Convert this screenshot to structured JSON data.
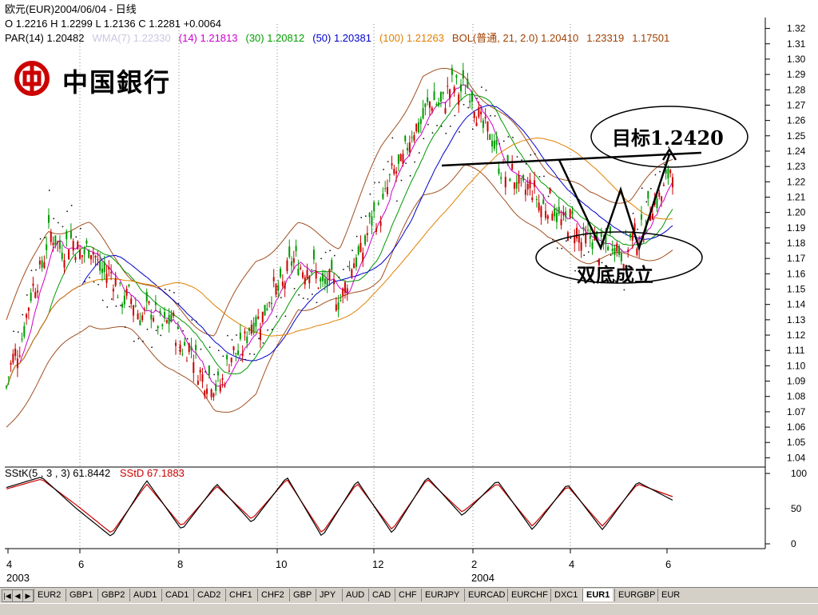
{
  "header": {
    "line1": "欧元(EUR)2004/06/04 - 日线",
    "line2": "O 1.2216 H 1.2299 L 1.2136 C 1.2281 +0.0064",
    "indicators": [
      {
        "text": "PAR(14)  1.20482",
        "color": "#000000"
      },
      {
        "text": "WMA(7) 1.22330",
        "color": "#c8c8e0"
      },
      {
        "text": "(14) 1.21813",
        "color": "#cc00cc"
      },
      {
        "text": "(30) 1.20812",
        "color": "#00a000"
      },
      {
        "text": "(50) 1.20381",
        "color": "#0000cc"
      },
      {
        "text": "(100) 1.21263",
        "color": "#e08000"
      },
      {
        "text": "BOL(普通, 21, 2.0)  1.20410",
        "color": "#a04000"
      },
      {
        "text": "1.23319",
        "color": "#a04000"
      },
      {
        "text": "1.17501",
        "color": "#a04000"
      }
    ]
  },
  "logo": {
    "text": "中国銀行",
    "color": "#cc0000"
  },
  "annotations": {
    "target": "目标1.2420",
    "pattern": "双底成立"
  },
  "stoch_header": {
    "k_label": "SStK(5 , 3 , 3)  61.8442",
    "d_label": "SStD  67.1883",
    "k_color": "#000000",
    "d_color": "#cc0000"
  },
  "tabs": [
    "EUR2",
    "GBP1",
    "GBP2",
    "AUD1",
    "CAD1",
    "CAD2",
    "CHF1",
    "CHF2",
    "GBP",
    "JPY",
    "AUD",
    "CAD",
    "CHF",
    "EURJPY",
    "EURCAD",
    "EURCHF",
    "DXC1",
    "EUR1",
    "EURGBP",
    "EUR"
  ],
  "active_tab": "EUR1",
  "chart_data": [
    {
      "type": "line",
      "title": "欧元(EUR)2004/06/04 - 日线",
      "y_ticks": [
        "1.32",
        "1.31",
        "1.30",
        "1.29",
        "1.28",
        "1.27",
        "1.26",
        "1.25",
        "1.24",
        "1.23",
        "1.22",
        "1.21",
        "1.20",
        "1.19",
        "1.18",
        "1.17",
        "1.16",
        "1.15",
        "1.14",
        "1.13",
        "1.12",
        "1.11",
        "1.10",
        "1.09",
        "1.08",
        "1.07",
        "1.06",
        "1.05",
        "1.04"
      ],
      "ylim": [
        1.035,
        1.325
      ],
      "x_ticks": [
        "4",
        "6",
        "8",
        "10",
        "12",
        "2",
        "4",
        "6"
      ],
      "x_year_labels": [
        "2003",
        "2004"
      ],
      "colors": {
        "price": "#009900",
        "up": "#cc0000",
        "wma7": "#cc00cc",
        "ma30": "#009900",
        "ma50": "#0000cc",
        "ma100": "#e08000",
        "boll": "#a05020",
        "sar": "#000000"
      },
      "x": [
        "2003-04",
        "2003-05",
        "2003-06",
        "2003-06b",
        "2003-07",
        "2003-08",
        "2003-09",
        "2003-10",
        "2003-11",
        "2003-12",
        "2004-01",
        "2004-02",
        "2004-03",
        "2004-04",
        "2004-05",
        "2004-05b",
        "2004-06"
      ],
      "series": [
        {
          "name": "Close",
          "values": [
            1.086,
            1.183,
            1.175,
            1.14,
            1.125,
            1.085,
            1.13,
            1.17,
            1.145,
            1.205,
            1.265,
            1.285,
            1.225,
            1.205,
            1.18,
            1.178,
            1.228
          ]
        },
        {
          "name": "BOL upper",
          "values": [
            1.13,
            1.19,
            1.19,
            1.16,
            1.14,
            1.12,
            1.17,
            1.19,
            1.18,
            1.24,
            1.29,
            1.29,
            1.26,
            1.23,
            1.21,
            1.21,
            1.235
          ]
        },
        {
          "name": "BOL lower",
          "values": [
            1.06,
            1.1,
            1.13,
            1.12,
            1.1,
            1.07,
            1.08,
            1.14,
            1.14,
            1.16,
            1.21,
            1.23,
            1.21,
            1.18,
            1.17,
            1.17,
            1.175
          ]
        }
      ],
      "annotations": [
        {
          "text": "目标1.2420",
          "value": 1.242
        },
        {
          "text": "双底成立"
        }
      ]
    },
    {
      "type": "line",
      "title": "SStK(5 , 3 , 3)",
      "y_ticks": [
        "100",
        "50",
        "0"
      ],
      "ylim": [
        0,
        100
      ],
      "series": [
        {
          "name": "SStK",
          "values": [
            80,
            95,
            50,
            10,
            90,
            20,
            85,
            30,
            95,
            10,
            90,
            15,
            95,
            40,
            90,
            20,
            85,
            20,
            88,
            62
          ]
        },
        {
          "name": "SStD",
          "values": [
            78,
            92,
            55,
            15,
            85,
            25,
            82,
            35,
            92,
            15,
            86,
            20,
            92,
            45,
            86,
            25,
            82,
            25,
            85,
            67
          ]
        }
      ]
    }
  ]
}
